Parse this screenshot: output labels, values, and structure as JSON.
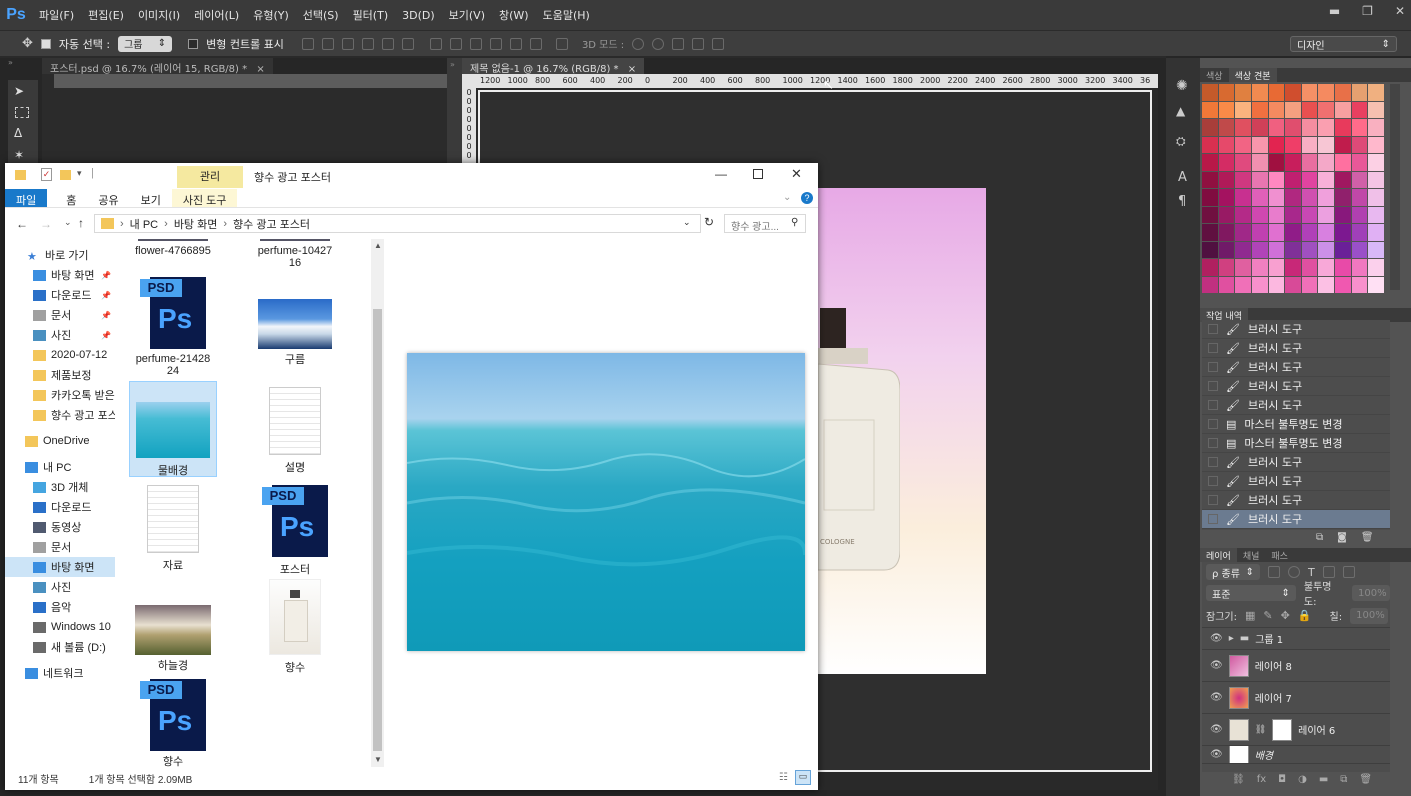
{
  "menubar": {
    "logo": "Ps",
    "items": [
      "파일(F)",
      "편집(E)",
      "이미지(I)",
      "레이어(L)",
      "유형(Y)",
      "선택(S)",
      "필터(T)",
      "3D(D)",
      "보기(V)",
      "창(W)",
      "도움말(H)"
    ]
  },
  "options": {
    "auto_select_label": "자동 선택 :",
    "group_value": "그룹",
    "transform_label": "변형 컨트롤 표시",
    "mode3d_label": "3D 모드 :",
    "workspace": "디자인"
  },
  "doc_tabs": {
    "tab1": "포스터.psd @ 16.7% (레이어 15, RGB/8) *",
    "tab2": "제목 없음-1 @ 16.7% (RGB/8) *",
    "close": "×"
  },
  "ruler_ticks": [
    "1200",
    "1000",
    "800",
    "600",
    "400",
    "200",
    "0",
    "200",
    "400",
    "600",
    "800",
    "1000",
    "1200",
    "1400",
    "1600",
    "1800",
    "2000",
    "2200",
    "2400",
    "2600",
    "2800",
    "3000",
    "3200",
    "3400",
    "36"
  ],
  "panels": {
    "color_tab": "색상",
    "swatch_tab": "색상 견본",
    "history_tab": "작업 내역",
    "history": [
      "브러시 도구",
      "브러시 도구",
      "브러시 도구",
      "브러시 도구",
      "브러시 도구",
      "마스터 불투명도 변경",
      "마스터 불투명도 변경",
      "브러시 도구",
      "브러시 도구",
      "브러시 도구",
      "브러시 도구"
    ],
    "layers_tabs": [
      "레이어",
      "채널",
      "패스"
    ],
    "kind_filter": "ρ 종류",
    "blend_mode": "표준",
    "opacity_label": "불투명도:",
    "opacity_value": "100%",
    "lock_label": "잠그기:",
    "fill_label": "칠:",
    "fill_value": "100%",
    "layers": [
      "그룹 1",
      "레이어 8",
      "레이어 7",
      "레이어 6",
      "배경"
    ]
  },
  "swatch_colors": [
    "#c45a2a",
    "#d86a30",
    "#e08040",
    "#f08a50",
    "#e86a34",
    "#d04e2e",
    "#f59066",
    "#f58a60",
    "#e87048",
    "#e5a070",
    "#f0b080",
    "#f07838",
    "#f98a48",
    "#fbb37e",
    "#f07040",
    "#f48a60",
    "#f4a080",
    "#e85050",
    "#f07070",
    "#f7a0a0",
    "#e84060",
    "#f6c0b0",
    "#a83e3a",
    "#c04a4a",
    "#e05060",
    "#d04058",
    "#f06080",
    "#e04e6e",
    "#f48da0",
    "#fa9fb0",
    "#e83a5c",
    "#ff6b8a",
    "#f9b0c0",
    "#d83050",
    "#e6496a",
    "#f26484",
    "#f896ac",
    "#e22450",
    "#ef3e68",
    "#f8afc4",
    "#f7c6d4",
    "#c01c4c",
    "#de4a78",
    "#ffb8cc",
    "#b81848",
    "#d42c64",
    "#e04a7e",
    "#f090b0",
    "#a01040",
    "#c81e5c",
    "#e86ea0",
    "#f4a8c8",
    "#ff70a0",
    "#e85898",
    "#fcd0e4",
    "#901040",
    "#b01a58",
    "#d03880",
    "#e876b0",
    "#ff88c0",
    "#c02070",
    "#e044a0",
    "#f8b0d8",
    "#a01860",
    "#d060a8",
    "#f4c4e4",
    "#800c40",
    "#a41260",
    "#c83090",
    "#e060b8",
    "#f090d0",
    "#b02880",
    "#d050b0",
    "#f0a0dc",
    "#90206c",
    "#c048a8",
    "#f0c0e8",
    "#701040",
    "#981a64",
    "#b42a88",
    "#d048b0",
    "#e87ccc",
    "#a8288c",
    "#c848b4",
    "#eca0e0",
    "#88187c",
    "#b040b0",
    "#e8b8f0",
    "#601040",
    "#801860",
    "#a02888",
    "#c040b0",
    "#e070d0",
    "#901c88",
    "#b040b8",
    "#d880e0",
    "#7c1890",
    "#a040b8",
    "#e0b0f4",
    "#501040",
    "#701a68",
    "#902a90",
    "#b044b8",
    "#d070d8",
    "#803098",
    "#a050c0",
    "#cc90e8",
    "#6a2098",
    "#9a50c8",
    "#d8b8f8",
    "#b02060",
    "#d04080",
    "#e060a0",
    "#f080c0",
    "#f8a0d0",
    "#c82878",
    "#e050a0",
    "#f8a8d8",
    "#e84aa8",
    "#f078c0",
    "#fbd0ec",
    "#c03080",
    "#e050a0",
    "#f070b8",
    "#f890cc",
    "#fcb8e0",
    "#d84a98",
    "#f070b8",
    "#fcc0e4",
    "#f058b0",
    "#f890cc",
    "#ffe0f4"
  ],
  "explorer": {
    "quick": "|",
    "manage": "관리",
    "title": "향수 광고 포스터",
    "ribbon": [
      "파일",
      "홈",
      "공유",
      "보기",
      "사진 도구"
    ],
    "path": [
      "내 PC",
      "바탕 화면",
      "향수 광고 포스터"
    ],
    "search_placeholder": "향수 광고...",
    "nav": [
      {
        "label": "바로 가기",
        "icon": "star-icon",
        "color": "#3b7fd6"
      },
      {
        "label": "바탕 화면",
        "icon": "desktop-icon",
        "color": "#3a8ee0"
      },
      {
        "label": "다운로드",
        "icon": "download-icon",
        "color": "#2a70c8"
      },
      {
        "label": "문서",
        "icon": "document-icon",
        "color": "#a0a0a0"
      },
      {
        "label": "사진",
        "icon": "pictures-icon",
        "color": "#4a90c0"
      },
      {
        "label": "2020-07-12",
        "icon": "folder-icon",
        "color": "#f3c65a"
      },
      {
        "label": "제품보정",
        "icon": "folder-icon",
        "color": "#f3c65a"
      },
      {
        "label": "카카오톡 받은",
        "icon": "folder-icon",
        "color": "#f3c65a"
      },
      {
        "label": "향수 광고 포스",
        "icon": "folder-icon",
        "color": "#f3c65a"
      },
      {
        "label": "OneDrive",
        "icon": "onedrive-icon",
        "color": "#f3c65a"
      },
      {
        "label": "내 PC",
        "icon": "pc-icon",
        "color": "#3a8ee0"
      },
      {
        "label": "3D 개체",
        "icon": "cube-icon",
        "color": "#45a5e0"
      },
      {
        "label": "다운로드",
        "icon": "download-icon",
        "color": "#2a70c8"
      },
      {
        "label": "동영상",
        "icon": "video-icon",
        "color": "#505a70"
      },
      {
        "label": "문서",
        "icon": "document-icon",
        "color": "#a0a0a0"
      },
      {
        "label": "바탕 화면",
        "icon": "desktop-icon",
        "color": "#3a8ee0"
      },
      {
        "label": "사진",
        "icon": "pictures-icon",
        "color": "#4a90c0"
      },
      {
        "label": "음악",
        "icon": "music-icon",
        "color": "#2a70c8"
      },
      {
        "label": "Windows 10",
        "icon": "drive-icon",
        "color": "#6a6a6a"
      },
      {
        "label": "새 볼륨 (D:)",
        "icon": "drive-icon",
        "color": "#6a6a6a"
      },
      {
        "label": "네트워크",
        "icon": "network-icon",
        "color": "#3a8ee0"
      }
    ],
    "files": {
      "f1": "flower-4766895",
      "f2": "perfume-1042716",
      "f3": "perfume-2142824",
      "f4": "구름",
      "f5": "물배경",
      "f6": "설명",
      "f7": "자료",
      "f8": "포스터",
      "f9": "하늘경",
      "f10": "향수",
      "f11": "향수"
    },
    "status_count": "11개 항목",
    "status_selected": "1개 항목 선택함 2.09MB"
  }
}
